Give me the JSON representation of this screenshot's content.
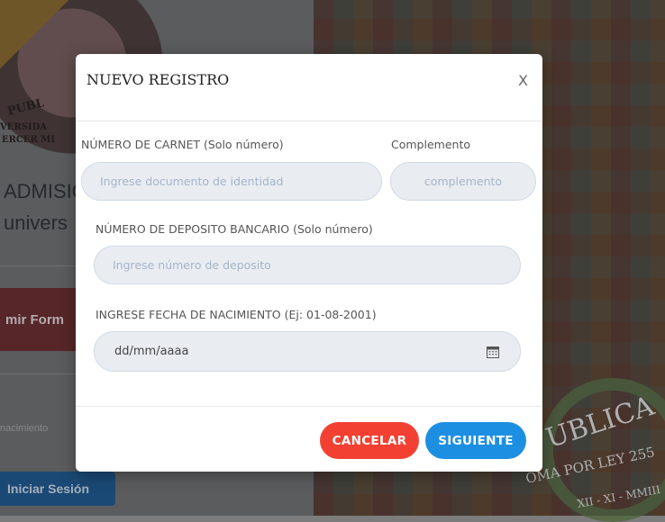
{
  "background": {
    "logo_text_1": "PUBL",
    "logo_text_2": "VERSIDA",
    "logo_text_3": "ERCER MI",
    "heading_line1": "ADMISIÓ",
    "heading_line2": "univers",
    "print_button": "mir Form",
    "nacimiento_placeholder": "nacimiento",
    "login_button": "Iniciar Sesión",
    "seal_text_1": "UBLICA",
    "seal_text_2": "OMA POR LEY 255",
    "seal_text_3": "XII - XI - MMIII"
  },
  "modal": {
    "title": "NUEVO REGISTRO",
    "close_label": "X",
    "carnet": {
      "label": "NÚMERO DE CARNET (Solo número)",
      "placeholder": "Ingrese documento de identidad",
      "value": ""
    },
    "complemento": {
      "label": "Complemento",
      "placeholder": "complemento",
      "value": ""
    },
    "deposito": {
      "label": "NÚMERO DE DEPOSITO BANCARIO (Solo número)",
      "placeholder": "Ingrese número de deposito",
      "value": ""
    },
    "fecha": {
      "label": "INGRESE FECHA DE NACIMIENTO (Ej: 01-08-2001)",
      "placeholder": "dd/mm/aaaa"
    },
    "buttons": {
      "cancel": "CANCELAR",
      "next": "SIGUIENTE"
    }
  },
  "colors": {
    "cancel": "#f24032",
    "next": "#1d8fe3",
    "field_bg": "#e9edf2",
    "placeholder": "#a5b4c8"
  },
  "icons": {
    "close": "close-icon",
    "calendar": "calendar-icon"
  }
}
